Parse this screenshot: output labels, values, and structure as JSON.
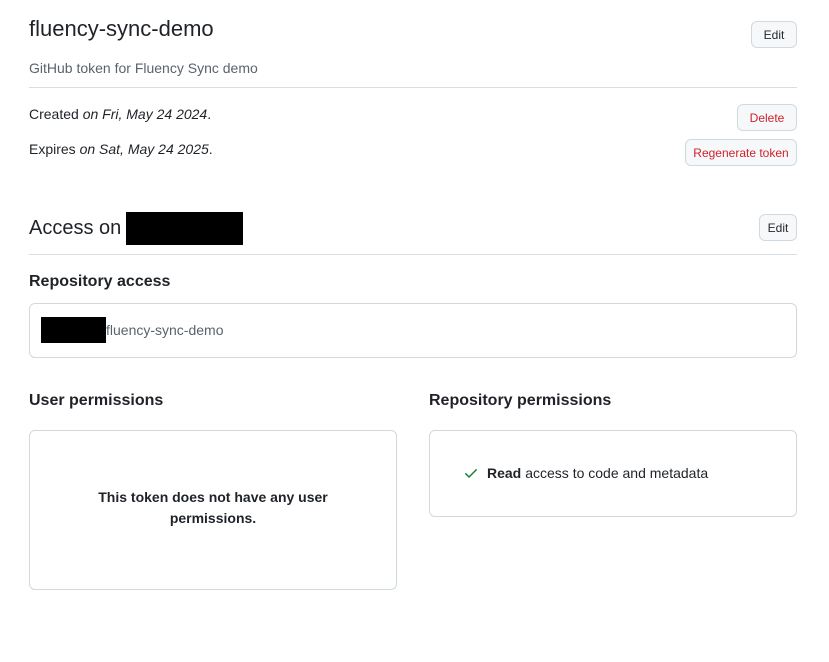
{
  "token": {
    "name": "fluency-sync-demo",
    "description": "GitHub token for Fluency Sync demo",
    "edit_label": "Edit",
    "created_prefix": "Created",
    "created_date": "on Fri, May 24 2024",
    "expires_prefix": "Expires",
    "expires_date": "on Sat, May 24 2025",
    "delete_label": "Delete",
    "regenerate_label": "Regenerate token"
  },
  "access": {
    "title_prefix": "Access on",
    "edit_label": "Edit"
  },
  "repository_access": {
    "heading": "Repository access",
    "repo_name": "fluency-sync-demo"
  },
  "user_permissions": {
    "heading": "User permissions",
    "empty_message": "This token does not have any user permissions."
  },
  "repository_permissions": {
    "heading": "Repository permissions",
    "items": [
      {
        "level": "Read",
        "text": "access to code and metadata",
        "icon": "check-icon"
      }
    ]
  },
  "colors": {
    "danger": "#cf222e",
    "success": "#1a7f37",
    "border": "#d1d9e0"
  }
}
